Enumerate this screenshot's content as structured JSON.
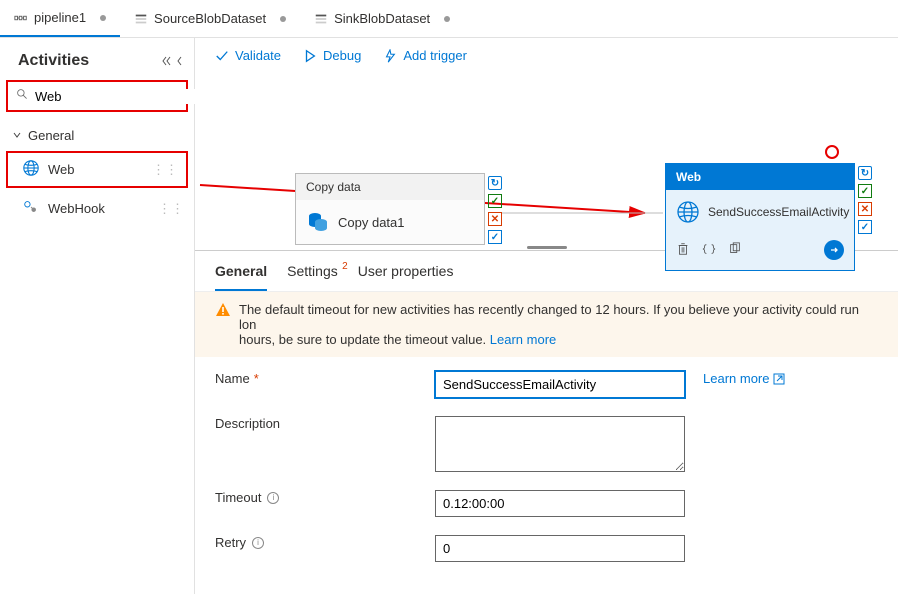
{
  "tabs": {
    "pipeline": "pipeline1",
    "source_ds": "SourceBlobDataset",
    "sink_ds": "SinkBlobDataset"
  },
  "sidebar": {
    "title": "Activities",
    "search_value": "Web",
    "category_general": "General",
    "item_web": "Web",
    "item_webhook": "WebHook"
  },
  "toolbar": {
    "validate": "Validate",
    "debug": "Debug",
    "addtrigger": "Add trigger"
  },
  "canvas": {
    "copy_node_head": "Copy data",
    "copy_node_name": "Copy data1",
    "web_node_head": "Web",
    "web_node_name": "SendSuccessEmailActivity"
  },
  "details": {
    "tab_general": "General",
    "tab_settings": "Settings",
    "tab_settings_badge": "2",
    "tab_userprops": "User properties",
    "warning_text_a": "The default timeout for new activities has recently changed to 12 hours. If you believe your activity could run lon",
    "warning_text_b": "hours, be sure to update the timeout value. ",
    "warning_learn": "Learn more",
    "form": {
      "name_label": "Name",
      "name_value": "SendSuccessEmailActivity",
      "learn_more": "Learn more",
      "desc_label": "Description",
      "desc_value": "",
      "timeout_label": "Timeout",
      "timeout_value": "0.12:00:00",
      "retry_label": "Retry",
      "retry_value": "0"
    }
  }
}
